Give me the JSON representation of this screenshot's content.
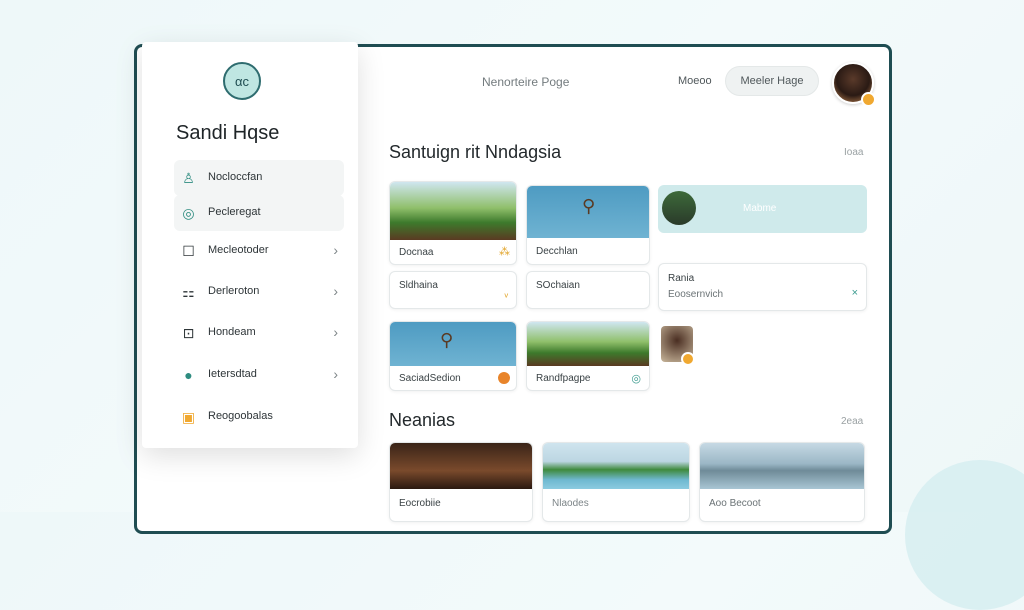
{
  "header": {
    "title": "Nenorteire Poge",
    "link": "Moeoo",
    "pill": "Meeler Hage"
  },
  "sidebar": {
    "logo": "αc",
    "user_name": "Sandi Hqse",
    "items": [
      {
        "label": "Nocloccfan",
        "icon": "person-icon",
        "glyph": "♙",
        "active": true,
        "chevron": false
      },
      {
        "label": "Pecleregat",
        "icon": "leaf-icon",
        "glyph": "◎",
        "active": true,
        "chevron": false
      },
      {
        "label": "Mecleotoder",
        "icon": "square-icon",
        "glyph": "☐",
        "active": false,
        "chevron": true
      },
      {
        "label": "Derleroton",
        "icon": "grid-icon",
        "glyph": "⚏",
        "active": false,
        "chevron": true
      },
      {
        "label": "Hondeam",
        "icon": "image-icon",
        "glyph": "⊡",
        "active": false,
        "chevron": true
      },
      {
        "label": "Ietersdtad",
        "icon": "globe-icon",
        "glyph": "●",
        "active": false,
        "chevron": true
      },
      {
        "label": "Reogoobalas",
        "icon": "bag-icon",
        "glyph": "▣",
        "active": false,
        "chevron": false
      }
    ]
  },
  "section1": {
    "title": "Santuign rit Nndagsia",
    "meta": "Ioaa"
  },
  "section2": {
    "title": "Neanias",
    "meta": "2eaa"
  },
  "cards": {
    "c1": "Docnaa",
    "c2": "Decchlan",
    "wide": "Mabme",
    "c4": "Sldhaina",
    "c5": "SOchaian",
    "form_label": "Rania",
    "form_value": "Eoosernvich",
    "c7": "SaciadSedion",
    "c8": "Randfpagpe",
    "b1": "Eocrobiie",
    "b2": "Nlaodes",
    "b3": "Aoo Becoot"
  },
  "colors": {
    "accent": "#2e6c6f",
    "badge": "#f0a830"
  }
}
